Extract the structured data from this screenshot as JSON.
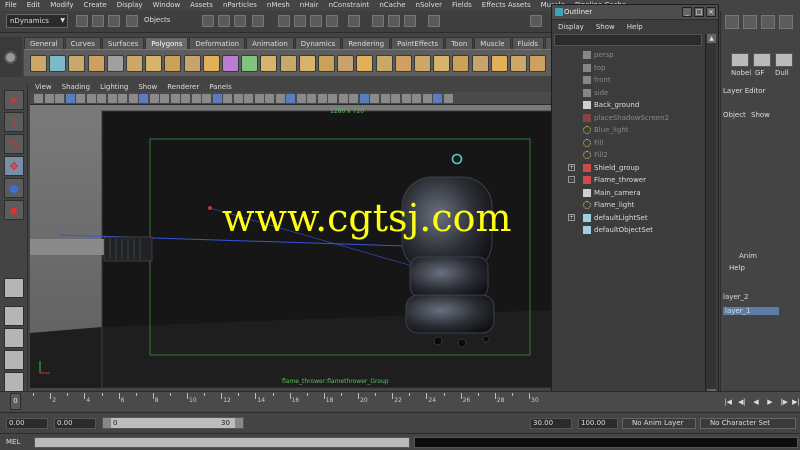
{
  "app": {
    "menu": [
      "File",
      "Edit",
      "Modify",
      "Create",
      "Display",
      "Window",
      "Assets",
      "nParticles",
      "nMesh",
      "nHair",
      "nConstraint",
      "nCache",
      "nSolver",
      "Fields",
      "Effects Assets",
      "Muscle",
      "Pipeline Cache"
    ]
  },
  "statusline": {
    "mode": "nDynamics",
    "objects_label": "Objects"
  },
  "shelf": {
    "tabs": [
      "General",
      "Curves",
      "Surfaces",
      "Polygons",
      "Deformation",
      "Animation",
      "Dynamics",
      "Rendering",
      "PaintEffects",
      "Toon",
      "Muscle",
      "Fluids",
      "Fur"
    ],
    "active_tab": "Polygons",
    "icon_colors": [
      "#c9a96a",
      "#7fb8c9",
      "#c9a96a",
      "#d0a060",
      "#a0a0a0",
      "#c9a96a",
      "#d7b36b",
      "#c8a25a",
      "#c7a46b",
      "#e1b058",
      "#b77fd1",
      "#7fc47f",
      "#d7b36b",
      "#c9a96a",
      "#d7b36b",
      "#c8a25a",
      "#c7a46b",
      "#e1b058",
      "#c9a96a",
      "#d0a060",
      "#c9a96a",
      "#d7b36b",
      "#c8a25a",
      "#c7a46b",
      "#e1b058",
      "#c9a96a",
      "#d0a060"
    ]
  },
  "toolbox": {
    "tools": [
      {
        "name": "select-tool",
        "glyph": "➤",
        "color": "#e03030"
      },
      {
        "name": "lasso-tool",
        "glyph": "⌇",
        "color": "#e03030"
      },
      {
        "name": "paint-select-tool",
        "glyph": "✎",
        "color": "#e03030"
      },
      {
        "name": "move-tool",
        "glyph": "✥",
        "color": "#e03030"
      },
      {
        "name": "rotate-tool",
        "glyph": "●",
        "color": "#3a6fd8"
      },
      {
        "name": "scale-tool",
        "glyph": "◆",
        "color": "#e03030"
      }
    ]
  },
  "viewport": {
    "panel_menu": [
      "View",
      "Shading",
      "Lighting",
      "Show",
      "Renderer",
      "Panels"
    ],
    "resolution_label": "1280 x 720",
    "camera_label": "flame_thrower:flamethrower_Group"
  },
  "watermark": {
    "text": "www.cgtsj.com",
    "color": "#ffff14"
  },
  "outliner": {
    "title": "Outliner",
    "menu": [
      "Display",
      "Show",
      "Help"
    ],
    "items": [
      {
        "label": "persp",
        "icon": "camera",
        "expand": "",
        "dim": true
      },
      {
        "label": "top",
        "icon": "camera",
        "expand": "",
        "dim": true
      },
      {
        "label": "front",
        "icon": "camera",
        "expand": "",
        "dim": true
      },
      {
        "label": "side",
        "icon": "camera",
        "expand": "",
        "dim": true
      },
      {
        "label": "Back_ground",
        "icon": "camera",
        "expand": "",
        "dim": false
      },
      {
        "label": "placeShadowScreen2",
        "icon": "mesh",
        "expand": "",
        "dim": true
      },
      {
        "label": "Blue_light",
        "icon": "light",
        "expand": "",
        "dim": true
      },
      {
        "label": "Fill",
        "icon": "light",
        "expand": "",
        "dim": true
      },
      {
        "label": "Fill2",
        "icon": "light",
        "expand": "",
        "dim": true
      },
      {
        "label": "Shield_group",
        "icon": "mesh",
        "expand": "+",
        "dim": false
      },
      {
        "label": "Flame_thrower",
        "icon": "mesh",
        "expand": "-",
        "dim": false
      },
      {
        "label": "Main_camera",
        "icon": "camera",
        "expand": "",
        "dim": false
      },
      {
        "label": "Flame_light",
        "icon": "light",
        "expand": "",
        "dim": false
      },
      {
        "label": "defaultLightSet",
        "icon": "set",
        "expand": "+",
        "dim": false
      },
      {
        "label": "defaultObjectSet",
        "icon": "set",
        "expand": "",
        "dim": false
      }
    ]
  },
  "rightpanel": {
    "shelf_labels": [
      "Nobel",
      "GF",
      "Dull"
    ],
    "tab_label": "Layer Editor",
    "object_label": "Object",
    "show_label": "Show",
    "anim_label": "Anim",
    "help_label": "Help",
    "layer2": "layer_2",
    "layer1": "layer_1"
  },
  "timeslider": {
    "current_frame": "0",
    "ticks": [
      "2",
      "4",
      "6",
      "8",
      "10",
      "12",
      "14",
      "16",
      "18",
      "20",
      "22",
      "24",
      "26",
      "28",
      "30"
    ]
  },
  "range": {
    "start": "0.00",
    "start2": "0.00",
    "bar_start": "0",
    "bar_end": "30",
    "end": "30.00",
    "end2": "100.00",
    "anim_layer": "No Anim Layer",
    "char_set": "No Character Set"
  },
  "cmdline": {
    "label": "MEL"
  }
}
